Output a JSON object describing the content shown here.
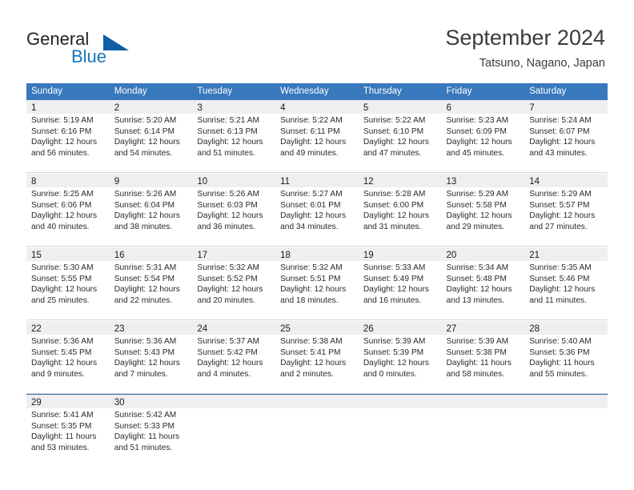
{
  "brand": {
    "name_part1": "General",
    "name_part2": "Blue",
    "logo_icon": "triangle-logo-icon"
  },
  "header": {
    "title": "September 2024",
    "subtitle": "Tatsuno, Nagano, Japan"
  },
  "colors": {
    "header_blue": "#3878bc",
    "brand_blue": "#1a75bb",
    "logo_blue": "#0e5ea4",
    "day_band_gray": "#efefef",
    "separator_gray": "#d9d9d9",
    "last_row_border": "#2f6aad",
    "text_dark": "#3c3c3c"
  },
  "weekday_headers": [
    "Sunday",
    "Monday",
    "Tuesday",
    "Wednesday",
    "Thursday",
    "Friday",
    "Saturday"
  ],
  "weeks": [
    {
      "days": [
        {
          "day": "1",
          "sunrise": "Sunrise: 5:19 AM",
          "sunset": "Sunset: 6:16 PM",
          "daylight_line1": "Daylight: 12 hours",
          "daylight_line2": "and 56 minutes."
        },
        {
          "day": "2",
          "sunrise": "Sunrise: 5:20 AM",
          "sunset": "Sunset: 6:14 PM",
          "daylight_line1": "Daylight: 12 hours",
          "daylight_line2": "and 54 minutes."
        },
        {
          "day": "3",
          "sunrise": "Sunrise: 5:21 AM",
          "sunset": "Sunset: 6:13 PM",
          "daylight_line1": "Daylight: 12 hours",
          "daylight_line2": "and 51 minutes."
        },
        {
          "day": "4",
          "sunrise": "Sunrise: 5:22 AM",
          "sunset": "Sunset: 6:11 PM",
          "daylight_line1": "Daylight: 12 hours",
          "daylight_line2": "and 49 minutes."
        },
        {
          "day": "5",
          "sunrise": "Sunrise: 5:22 AM",
          "sunset": "Sunset: 6:10 PM",
          "daylight_line1": "Daylight: 12 hours",
          "daylight_line2": "and 47 minutes."
        },
        {
          "day": "6",
          "sunrise": "Sunrise: 5:23 AM",
          "sunset": "Sunset: 6:09 PM",
          "daylight_line1": "Daylight: 12 hours",
          "daylight_line2": "and 45 minutes."
        },
        {
          "day": "7",
          "sunrise": "Sunrise: 5:24 AM",
          "sunset": "Sunset: 6:07 PM",
          "daylight_line1": "Daylight: 12 hours",
          "daylight_line2": "and 43 minutes."
        }
      ]
    },
    {
      "days": [
        {
          "day": "8",
          "sunrise": "Sunrise: 5:25 AM",
          "sunset": "Sunset: 6:06 PM",
          "daylight_line1": "Daylight: 12 hours",
          "daylight_line2": "and 40 minutes."
        },
        {
          "day": "9",
          "sunrise": "Sunrise: 5:26 AM",
          "sunset": "Sunset: 6:04 PM",
          "daylight_line1": "Daylight: 12 hours",
          "daylight_line2": "and 38 minutes."
        },
        {
          "day": "10",
          "sunrise": "Sunrise: 5:26 AM",
          "sunset": "Sunset: 6:03 PM",
          "daylight_line1": "Daylight: 12 hours",
          "daylight_line2": "and 36 minutes."
        },
        {
          "day": "11",
          "sunrise": "Sunrise: 5:27 AM",
          "sunset": "Sunset: 6:01 PM",
          "daylight_line1": "Daylight: 12 hours",
          "daylight_line2": "and 34 minutes."
        },
        {
          "day": "12",
          "sunrise": "Sunrise: 5:28 AM",
          "sunset": "Sunset: 6:00 PM",
          "daylight_line1": "Daylight: 12 hours",
          "daylight_line2": "and 31 minutes."
        },
        {
          "day": "13",
          "sunrise": "Sunrise: 5:29 AM",
          "sunset": "Sunset: 5:58 PM",
          "daylight_line1": "Daylight: 12 hours",
          "daylight_line2": "and 29 minutes."
        },
        {
          "day": "14",
          "sunrise": "Sunrise: 5:29 AM",
          "sunset": "Sunset: 5:57 PM",
          "daylight_line1": "Daylight: 12 hours",
          "daylight_line2": "and 27 minutes."
        }
      ]
    },
    {
      "days": [
        {
          "day": "15",
          "sunrise": "Sunrise: 5:30 AM",
          "sunset": "Sunset: 5:55 PM",
          "daylight_line1": "Daylight: 12 hours",
          "daylight_line2": "and 25 minutes."
        },
        {
          "day": "16",
          "sunrise": "Sunrise: 5:31 AM",
          "sunset": "Sunset: 5:54 PM",
          "daylight_line1": "Daylight: 12 hours",
          "daylight_line2": "and 22 minutes."
        },
        {
          "day": "17",
          "sunrise": "Sunrise: 5:32 AM",
          "sunset": "Sunset: 5:52 PM",
          "daylight_line1": "Daylight: 12 hours",
          "daylight_line2": "and 20 minutes."
        },
        {
          "day": "18",
          "sunrise": "Sunrise: 5:32 AM",
          "sunset": "Sunset: 5:51 PM",
          "daylight_line1": "Daylight: 12 hours",
          "daylight_line2": "and 18 minutes."
        },
        {
          "day": "19",
          "sunrise": "Sunrise: 5:33 AM",
          "sunset": "Sunset: 5:49 PM",
          "daylight_line1": "Daylight: 12 hours",
          "daylight_line2": "and 16 minutes."
        },
        {
          "day": "20",
          "sunrise": "Sunrise: 5:34 AM",
          "sunset": "Sunset: 5:48 PM",
          "daylight_line1": "Daylight: 12 hours",
          "daylight_line2": "and 13 minutes."
        },
        {
          "day": "21",
          "sunrise": "Sunrise: 5:35 AM",
          "sunset": "Sunset: 5:46 PM",
          "daylight_line1": "Daylight: 12 hours",
          "daylight_line2": "and 11 minutes."
        }
      ]
    },
    {
      "days": [
        {
          "day": "22",
          "sunrise": "Sunrise: 5:36 AM",
          "sunset": "Sunset: 5:45 PM",
          "daylight_line1": "Daylight: 12 hours",
          "daylight_line2": "and 9 minutes."
        },
        {
          "day": "23",
          "sunrise": "Sunrise: 5:36 AM",
          "sunset": "Sunset: 5:43 PM",
          "daylight_line1": "Daylight: 12 hours",
          "daylight_line2": "and 7 minutes."
        },
        {
          "day": "24",
          "sunrise": "Sunrise: 5:37 AM",
          "sunset": "Sunset: 5:42 PM",
          "daylight_line1": "Daylight: 12 hours",
          "daylight_line2": "and 4 minutes."
        },
        {
          "day": "25",
          "sunrise": "Sunrise: 5:38 AM",
          "sunset": "Sunset: 5:41 PM",
          "daylight_line1": "Daylight: 12 hours",
          "daylight_line2": "and 2 minutes."
        },
        {
          "day": "26",
          "sunrise": "Sunrise: 5:39 AM",
          "sunset": "Sunset: 5:39 PM",
          "daylight_line1": "Daylight: 12 hours",
          "daylight_line2": "and 0 minutes."
        },
        {
          "day": "27",
          "sunrise": "Sunrise: 5:39 AM",
          "sunset": "Sunset: 5:38 PM",
          "daylight_line1": "Daylight: 11 hours",
          "daylight_line2": "and 58 minutes."
        },
        {
          "day": "28",
          "sunrise": "Sunrise: 5:40 AM",
          "sunset": "Sunset: 5:36 PM",
          "daylight_line1": "Daylight: 11 hours",
          "daylight_line2": "and 55 minutes."
        }
      ]
    },
    {
      "days": [
        {
          "day": "29",
          "sunrise": "Sunrise: 5:41 AM",
          "sunset": "Sunset: 5:35 PM",
          "daylight_line1": "Daylight: 11 hours",
          "daylight_line2": "and 53 minutes."
        },
        {
          "day": "30",
          "sunrise": "Sunrise: 5:42 AM",
          "sunset": "Sunset: 5:33 PM",
          "daylight_line1": "Daylight: 11 hours",
          "daylight_line2": "and 51 minutes."
        },
        {
          "day": "",
          "sunrise": "",
          "sunset": "",
          "daylight_line1": "",
          "daylight_line2": ""
        },
        {
          "day": "",
          "sunrise": "",
          "sunset": "",
          "daylight_line1": "",
          "daylight_line2": ""
        },
        {
          "day": "",
          "sunrise": "",
          "sunset": "",
          "daylight_line1": "",
          "daylight_line2": ""
        },
        {
          "day": "",
          "sunrise": "",
          "sunset": "",
          "daylight_line1": "",
          "daylight_line2": ""
        },
        {
          "day": "",
          "sunrise": "",
          "sunset": "",
          "daylight_line1": "",
          "daylight_line2": ""
        }
      ]
    }
  ]
}
